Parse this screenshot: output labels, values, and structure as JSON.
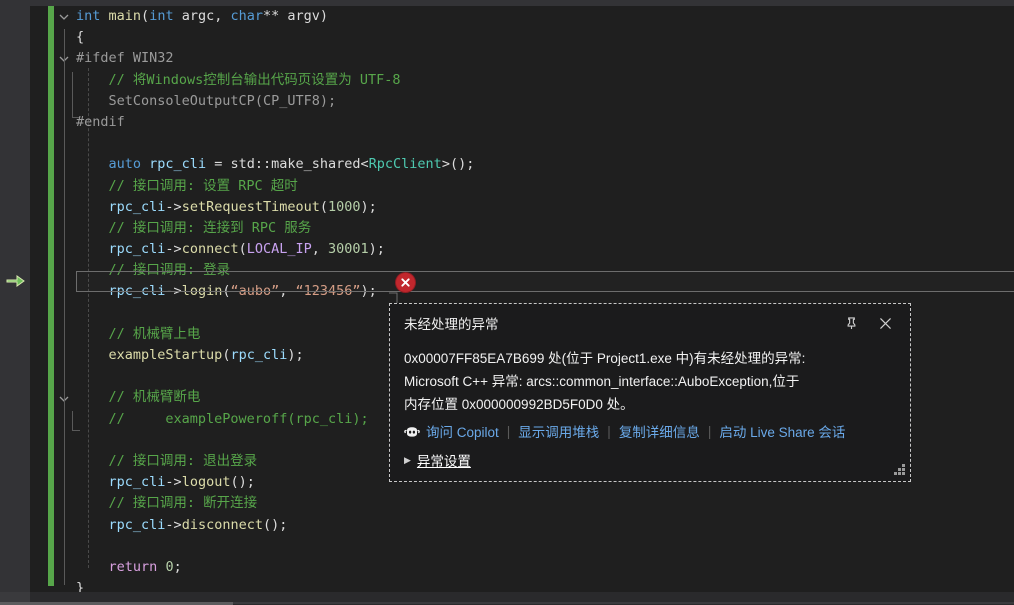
{
  "editor": {
    "language": "cpp",
    "execution_pointer_line": 12,
    "current_line_index": 12,
    "change_bar_color": "#57a64a",
    "background": "#1f1f1f",
    "code_lines": [
      {
        "indent": 0,
        "fold": "open",
        "tokens": [
          {
            "t": "int",
            "c": "kw"
          },
          {
            "t": " ",
            "c": "punc"
          },
          {
            "t": "main",
            "c": "fn"
          },
          {
            "t": "(",
            "c": "punc"
          },
          {
            "t": "int",
            "c": "kw"
          },
          {
            "t": " argc, ",
            "c": "punc"
          },
          {
            "t": "char",
            "c": "kw"
          },
          {
            "t": "** argv)",
            "c": "punc"
          }
        ]
      },
      {
        "indent": 0,
        "fold": "line",
        "tokens": [
          {
            "t": "{",
            "c": "punc"
          }
        ]
      },
      {
        "indent": 0,
        "fold": "open",
        "tokens": [
          {
            "t": "#ifdef WIN32",
            "c": "mac"
          }
        ]
      },
      {
        "indent": 1,
        "fold": "guide",
        "tokens": [
          {
            "t": "    // 将Windows控制台输出代码页设置为 UTF-8",
            "c": "com"
          }
        ]
      },
      {
        "indent": 1,
        "fold": "guide",
        "tokens": [
          {
            "t": "    ",
            "c": "punc"
          },
          {
            "t": "SetConsoleOutputCP",
            "c": "mac"
          },
          {
            "t": "(",
            "c": "mac"
          },
          {
            "t": "CP_UTF8",
            "c": "mac"
          },
          {
            "t": ");",
            "c": "mac"
          }
        ]
      },
      {
        "indent": 0,
        "fold": "end",
        "tokens": [
          {
            "t": "#endif",
            "c": "mac"
          }
        ]
      },
      {
        "indent": 1,
        "fold": "guide",
        "tokens": []
      },
      {
        "indent": 1,
        "fold": "guide",
        "tokens": [
          {
            "t": "    ",
            "c": "punc"
          },
          {
            "t": "auto",
            "c": "kw"
          },
          {
            "t": " ",
            "c": "punc"
          },
          {
            "t": "rpc_cli",
            "c": "var"
          },
          {
            "t": " = std::",
            "c": "punc"
          },
          {
            "t": "make_shared",
            "c": "punc"
          },
          {
            "t": "<",
            "c": "punc"
          },
          {
            "t": "RpcClient",
            "c": "typ"
          },
          {
            "t": ">();",
            "c": "punc"
          }
        ]
      },
      {
        "indent": 1,
        "fold": "guide",
        "tokens": [
          {
            "t": "    // 接口调用: 设置 RPC 超时",
            "c": "com"
          }
        ]
      },
      {
        "indent": 1,
        "fold": "guide",
        "tokens": [
          {
            "t": "    ",
            "c": "punc"
          },
          {
            "t": "rpc_cli",
            "c": "var"
          },
          {
            "t": "->",
            "c": "punc"
          },
          {
            "t": "setRequestTimeout",
            "c": "fn"
          },
          {
            "t": "(",
            "c": "punc"
          },
          {
            "t": "1000",
            "c": "num"
          },
          {
            "t": ");",
            "c": "punc"
          }
        ]
      },
      {
        "indent": 1,
        "fold": "guide",
        "tokens": [
          {
            "t": "    // 接口调用: 连接到 RPC 服务",
            "c": "com"
          }
        ]
      },
      {
        "indent": 1,
        "fold": "guide",
        "tokens": [
          {
            "t": "    ",
            "c": "punc"
          },
          {
            "t": "rpc_cli",
            "c": "var"
          },
          {
            "t": "->",
            "c": "punc"
          },
          {
            "t": "connect",
            "c": "fn"
          },
          {
            "t": "(",
            "c": "punc"
          },
          {
            "t": "LOCAL_IP",
            "c": "cnst"
          },
          {
            "t": ", ",
            "c": "punc"
          },
          {
            "t": "30001",
            "c": "num"
          },
          {
            "t": ");",
            "c": "punc"
          }
        ]
      },
      {
        "indent": 1,
        "fold": "guide",
        "tokens": [
          {
            "t": "    // 接口调用: 登录",
            "c": "com"
          }
        ]
      },
      {
        "indent": 1,
        "fold": "guide",
        "tokens": [
          {
            "t": "    ",
            "c": "punc"
          },
          {
            "t": "rpc_cli",
            "c": "var"
          },
          {
            "t": "->",
            "c": "punc"
          },
          {
            "t": "login",
            "c": "fn"
          },
          {
            "t": "(",
            "c": "punc"
          },
          {
            "t": "“aubo”",
            "c": "str"
          },
          {
            "t": ", ",
            "c": "punc"
          },
          {
            "t": "“123456”",
            "c": "str"
          },
          {
            "t": ");",
            "c": "punc"
          }
        ]
      },
      {
        "indent": 1,
        "fold": "guide",
        "tokens": []
      },
      {
        "indent": 1,
        "fold": "guide",
        "tokens": [
          {
            "t": "    // 机械臂上电",
            "c": "com"
          }
        ]
      },
      {
        "indent": 1,
        "fold": "guide",
        "tokens": [
          {
            "t": "    ",
            "c": "punc"
          },
          {
            "t": "exampleStartup",
            "c": "fn"
          },
          {
            "t": "(",
            "c": "punc"
          },
          {
            "t": "rpc_cli",
            "c": "var"
          },
          {
            "t": ");",
            "c": "punc"
          }
        ]
      },
      {
        "indent": 1,
        "fold": "guide",
        "tokens": []
      },
      {
        "indent": 1,
        "fold": "open2",
        "tokens": [
          {
            "t": "    // 机械臂断电",
            "c": "com"
          }
        ]
      },
      {
        "indent": 1,
        "fold": "end2",
        "tokens": [
          {
            "t": "    //     examplePoweroff(rpc_cli);",
            "c": "com"
          }
        ]
      },
      {
        "indent": 1,
        "fold": "guide",
        "tokens": []
      },
      {
        "indent": 1,
        "fold": "guide",
        "tokens": [
          {
            "t": "    // 接口调用: 退出登录",
            "c": "com"
          }
        ]
      },
      {
        "indent": 1,
        "fold": "guide",
        "tokens": [
          {
            "t": "    ",
            "c": "punc"
          },
          {
            "t": "rpc_cli",
            "c": "var"
          },
          {
            "t": "->",
            "c": "punc"
          },
          {
            "t": "logout",
            "c": "fn"
          },
          {
            "t": "();",
            "c": "punc"
          }
        ]
      },
      {
        "indent": 1,
        "fold": "guide",
        "tokens": [
          {
            "t": "    // 接口调用: 断开连接",
            "c": "com"
          }
        ]
      },
      {
        "indent": 1,
        "fold": "guide",
        "tokens": [
          {
            "t": "    ",
            "c": "punc"
          },
          {
            "t": "rpc_cli",
            "c": "var"
          },
          {
            "t": "->",
            "c": "punc"
          },
          {
            "t": "disconnect",
            "c": "fn"
          },
          {
            "t": "();",
            "c": "punc"
          }
        ]
      },
      {
        "indent": 1,
        "fold": "guide",
        "tokens": []
      },
      {
        "indent": 1,
        "fold": "guide",
        "tokens": [
          {
            "t": "    ",
            "c": "punc"
          },
          {
            "t": "return",
            "c": "kw2"
          },
          {
            "t": " ",
            "c": "punc"
          },
          {
            "t": "0",
            "c": "num"
          },
          {
            "t": ";",
            "c": "punc"
          }
        ]
      },
      {
        "indent": 0,
        "fold": "lineend",
        "tokens": [
          {
            "t": "}",
            "c": "punc"
          }
        ]
      }
    ]
  },
  "error_glyph": {
    "icon": "error-x-icon",
    "color": "#c1272d"
  },
  "dialog": {
    "title": "未经处理的异常",
    "pin_icon": "pin-icon",
    "close_icon": "close-icon",
    "message_lines": [
      "0x00007FF85EA7B699 处(位于 Project1.exe 中)有未经处理的异常:",
      "Microsoft C++ 异常: arcs::common_interface::AuboException,位于",
      "内存位置 0x000000992BD5F0D0 处。"
    ],
    "links": [
      {
        "label": "询问 Copilot",
        "icon": "copilot-icon"
      },
      {
        "label": "显示调用堆栈"
      },
      {
        "label": "复制详细信息"
      },
      {
        "label": "启动 Live Share 会话"
      }
    ],
    "settings_label": "异常设置",
    "settings_caret": "▶",
    "resize_grip_icon": "resize-grip-icon",
    "link_color": "#6aa9e9",
    "background": "#1b1b1c"
  }
}
